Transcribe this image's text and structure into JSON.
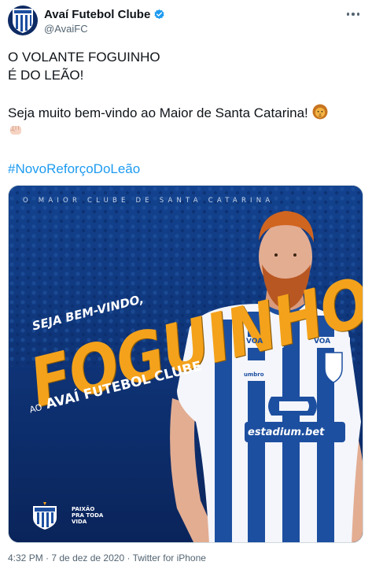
{
  "account": {
    "display_name": "Avaí Futebol Clube",
    "handle": "@AvaiFC",
    "avatar_icon": "avai-crest-icon",
    "verified_icon": "verified-badge-icon",
    "verified_color": "#1d9bf0",
    "avatar_text": "AVAÍ F.C."
  },
  "menu_icon": "more-options-icon",
  "tweet": {
    "line1": "O VOLANTE FOGUINHO",
    "line2": "É DO LEÃO!",
    "line3": "Seja muito bem-vindo ao Maior de Santa Catarina!",
    "line3_emoji": "lion-face-emoji",
    "line4_emoji": "fist-emoji",
    "hashtag": "#NovoReforçoDoLeão"
  },
  "media": {
    "tagline": "O MAIOR CLUBE DE SANTA CATARINA",
    "welcome": "SEJA BEM-VINDO,",
    "player_name": "FOGUINHO",
    "club_prefix": "AO",
    "club_name": "AVAÍ FUTEBOL CLUBE",
    "sponsor_chest": "VOA",
    "kit_brand": "umbro",
    "sponsor_shirt": "estadium.bet",
    "crest_label": "AVAÍ F.C.",
    "motto_1": "PAIXÃO",
    "motto_2": "PRA TODA",
    "motto_3": "VIDA",
    "accent_color": "#f4a21b"
  },
  "footer": {
    "time": "4:32 PM",
    "separator1": " · ",
    "date": "7 de dez de 2020",
    "separator2": " · ",
    "source": "Twitter for iPhone"
  }
}
